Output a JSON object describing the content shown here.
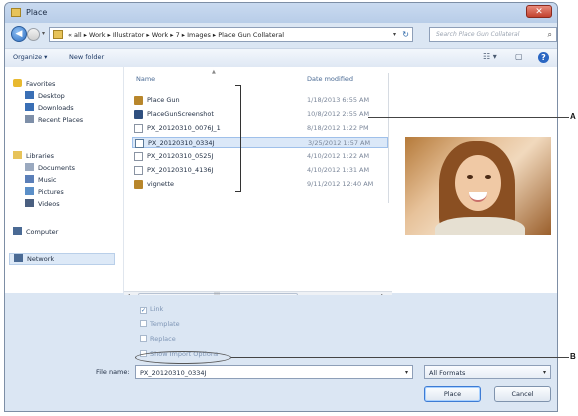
{
  "window": {
    "title": "Place",
    "close_glyph": "✕"
  },
  "nav": {
    "back_glyph": "◀",
    "dropdown_glyph": "▾",
    "address": "« all ▸ Work ▸ Illustrator ▸ Work ▸ 7 ▸ Images ▸ Place Gun Collateral",
    "refresh_glyph": "↻",
    "search_placeholder": "Search Place Gun Collateral",
    "search_glyph": "⌕"
  },
  "toolbar": {
    "organize": "Organize ▾",
    "new_folder": "New folder",
    "views_glyph": "☷ ▾",
    "pane_glyph": "▢",
    "help_glyph": "?"
  },
  "sidebar": {
    "items": [
      {
        "label": "Favorites",
        "icon": "star-icon",
        "color": "#e8b92f"
      },
      {
        "label": "Desktop",
        "icon": "desktop-icon",
        "color": "#3a6fb5"
      },
      {
        "label": "Downloads",
        "icon": "downloads-icon",
        "color": "#3a6fb5"
      },
      {
        "label": "Recent Places",
        "icon": "recent-places-icon",
        "color": "#7e8fa8"
      },
      {
        "label": "Libraries",
        "icon": "libraries-icon",
        "color": "#e7c35a"
      },
      {
        "label": "Documents",
        "icon": "documents-icon",
        "color": "#9aa9bf"
      },
      {
        "label": "Music",
        "icon": "music-icon",
        "color": "#5b7fb8"
      },
      {
        "label": "Pictures",
        "icon": "pictures-icon",
        "color": "#5b8fc8"
      },
      {
        "label": "Videos",
        "icon": "videos-icon",
        "color": "#4a5f80"
      },
      {
        "label": "Computer",
        "icon": "computer-icon",
        "color": "#4a6a94"
      },
      {
        "label": "Network",
        "icon": "network-icon",
        "color": "#4a6a94"
      }
    ]
  },
  "files": {
    "col_name": "Name",
    "col_date": "Date modified",
    "sort_glyph": "▲",
    "rows": [
      {
        "name": "Place Gun",
        "date": "1/18/2013 6:55 AM",
        "icon": "folder-icon",
        "color": "#b8862b"
      },
      {
        "name": "PlaceGunScreenshot",
        "date": "10/8/2012 2:55 AM",
        "icon": "folder-icon",
        "color": "#2f4f7f"
      },
      {
        "name": "PX_20120310_0076J_1",
        "date": "8/18/2012 1:22 PM",
        "icon": "image-file-icon",
        "color": "#8a94a3"
      },
      {
        "name": "PX_20120310_0334J",
        "date": "3/25/2012 1:57 AM",
        "icon": "image-file-icon",
        "color": "#5a7a9a"
      },
      {
        "name": "PX_20120310_0525J",
        "date": "4/10/2012 1:22 AM",
        "icon": "image-file-icon",
        "color": "#8a94a3"
      },
      {
        "name": "PX_20120310_4136J",
        "date": "4/10/2012 1:31 AM",
        "icon": "image-file-icon",
        "color": "#8a94a3"
      },
      {
        "name": "vignette",
        "date": "9/11/2012 12:40 AM",
        "icon": "ai-file-icon",
        "color": "#b8862b"
      }
    ]
  },
  "scroll": {
    "left": "◂",
    "right": "▸",
    "grip": "|||"
  },
  "options": {
    "link": "Link",
    "template": "Template",
    "replace": "Replace",
    "show_import": "Show Import Options",
    "check_glyph": "✓"
  },
  "filename": {
    "label": "File name:",
    "value": "PX_20120310_0334J",
    "drop_glyph": "▾"
  },
  "format": {
    "value": "All Formats",
    "drop_glyph": "▾"
  },
  "buttons": {
    "place": "Place",
    "cancel": "Cancel"
  },
  "callouts": {
    "a": "A",
    "b": "B"
  }
}
